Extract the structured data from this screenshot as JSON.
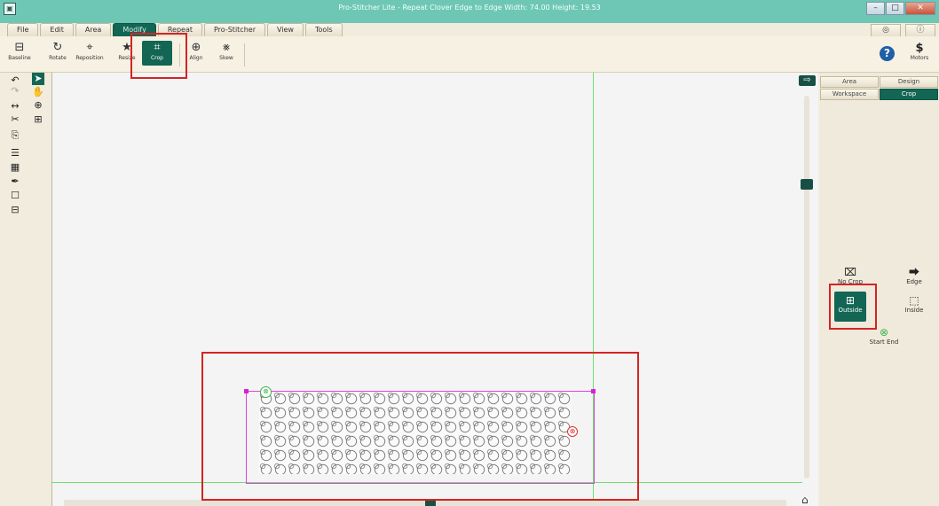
{
  "window": {
    "app_icon": "app-icon",
    "title": "Pro-Stitcher Lite  -  Repeat Clover Edge to Edge  Width: 74.00  Height: 19.53",
    "buttons": [
      "–",
      "□",
      "✕"
    ]
  },
  "menus": [
    {
      "label": "File"
    },
    {
      "label": "Edit"
    },
    {
      "label": "Area"
    },
    {
      "label": "Modify",
      "active": true
    },
    {
      "label": "Repeat"
    },
    {
      "label": "Pro-Stitcher"
    },
    {
      "label": "View"
    },
    {
      "label": "Tools"
    }
  ],
  "top_right": {
    "settings_icon": "◎",
    "info_icon": "ⓘ"
  },
  "ribbon": {
    "tools": [
      {
        "label": "Baseline",
        "icon": "⊟"
      },
      {
        "label": "Rotate",
        "icon": "↻"
      },
      {
        "label": "Reposition",
        "icon": "⌖"
      },
      {
        "label": "Resize",
        "icon": "★"
      },
      {
        "label": "Crop",
        "icon": "⌗",
        "active": true
      },
      {
        "label": "Align",
        "icon": "⊕"
      },
      {
        "label": "Skew",
        "icon": "⨳"
      }
    ],
    "help_icon": "?",
    "motors_icon": "$",
    "motors_label": "Motors"
  },
  "left_tools": [
    {
      "icon": "↶",
      "name": "undo-icon"
    },
    {
      "icon": "➤",
      "name": "select-pointer-icon",
      "active": true
    },
    {
      "icon": "↷",
      "name": "redo-icon"
    },
    {
      "icon": "✋",
      "name": "pan-hand-icon"
    },
    {
      "icon": "↔",
      "name": "fit-width-icon"
    },
    {
      "icon": "⊕",
      "name": "zoom-in-icon"
    },
    {
      "icon": "✂",
      "name": "measure-icon"
    },
    {
      "icon": "⊞",
      "name": "zoom-fit-icon"
    },
    {
      "icon": "⎘",
      "name": "page-icon"
    },
    {
      "icon": "☰",
      "name": "layers-icon"
    },
    {
      "icon": "▦",
      "name": "grid-icon"
    },
    {
      "icon": "✒",
      "name": "pen-icon"
    },
    {
      "icon": "☐",
      "name": "lock-icon"
    },
    {
      "icon": "⊟",
      "name": "stack-icon"
    }
  ],
  "canvas": {
    "arrow_icon": "⇨",
    "start_icon": "⊗",
    "end_icon": "⊗",
    "home_icon": "⌂"
  },
  "right_panel": {
    "tabs_row1": [
      {
        "label": "Area"
      },
      {
        "label": "Design"
      }
    ],
    "tabs_row2": [
      {
        "label": "Workspace"
      },
      {
        "label": "Crop",
        "active": true
      }
    ],
    "buttons": [
      {
        "label": "No Crop",
        "icon": "⌧"
      },
      {
        "label": "Edge",
        "icon": "⮕"
      },
      {
        "label": "Outside",
        "icon": "⊞",
        "active": true
      },
      {
        "label": "Inside",
        "icon": "⬚"
      },
      {
        "label": "Start End",
        "icon": "⊗"
      }
    ]
  },
  "colors": {
    "titlebar": "#6ec7b5",
    "accent": "#136654",
    "guide": "#6ede6e",
    "selection": "#e040e0",
    "highlight": "#d42424"
  }
}
